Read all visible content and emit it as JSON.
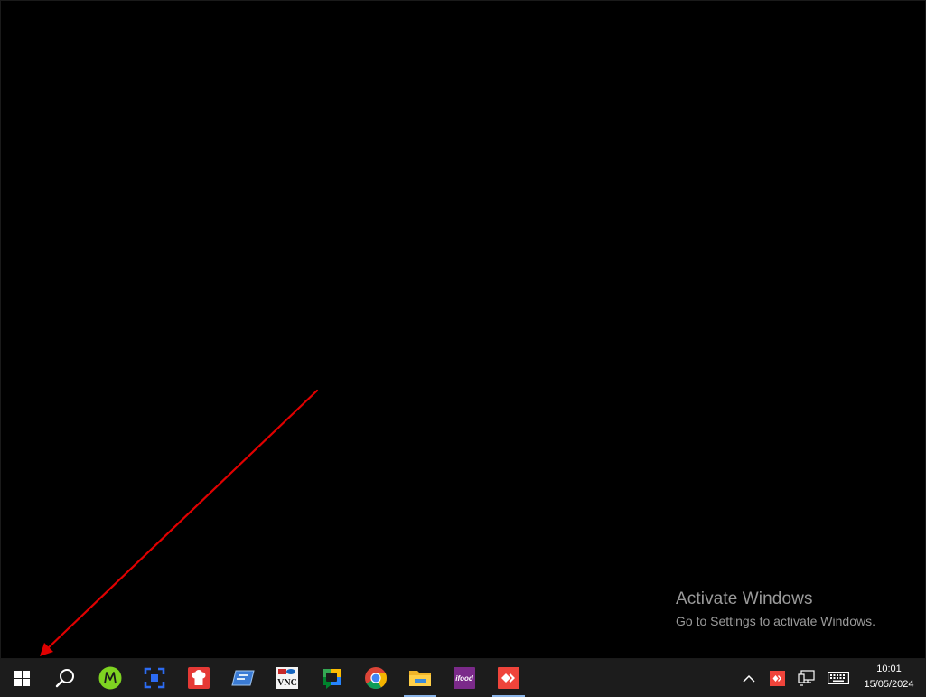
{
  "watermark": {
    "title": "Activate Windows",
    "subtitle": "Go to Settings to activate Windows."
  },
  "taskbar": {
    "start_icon": "windows-logo-icon",
    "search_icon": "search-icon",
    "apps": [
      {
        "icon": "green-m-app-icon",
        "active": false
      },
      {
        "icon": "blue-bracket-app-icon",
        "active": false
      },
      {
        "icon": "red-chef-app-icon",
        "active": false
      },
      {
        "icon": "blue-card-app-icon",
        "active": false
      },
      {
        "icon": "vnc-viewer-icon",
        "label": "VNC",
        "active": false
      },
      {
        "icon": "google-chat-icon",
        "active": false
      },
      {
        "icon": "chrome-icon",
        "active": false
      },
      {
        "icon": "file-explorer-icon",
        "active": true
      },
      {
        "icon": "ifood-icon",
        "label": "ifood",
        "active": false
      },
      {
        "icon": "anydesk-icon",
        "active": true
      }
    ]
  },
  "tray": {
    "chevron_icon": "chevron-up-icon",
    "anydesk_icon": "anydesk-tray-icon",
    "network_icon": "network-icon",
    "keyboard_icon": "keyboard-icon",
    "time": "10:01",
    "date": "15/05/2024"
  },
  "colors": {
    "desktop_bg": "#000000",
    "taskbar_bg": "#1c1c1c",
    "annotation_arrow": "#e00000",
    "active_indicator": "#8ab4e8",
    "watermark_text": "#9a9a9a"
  }
}
